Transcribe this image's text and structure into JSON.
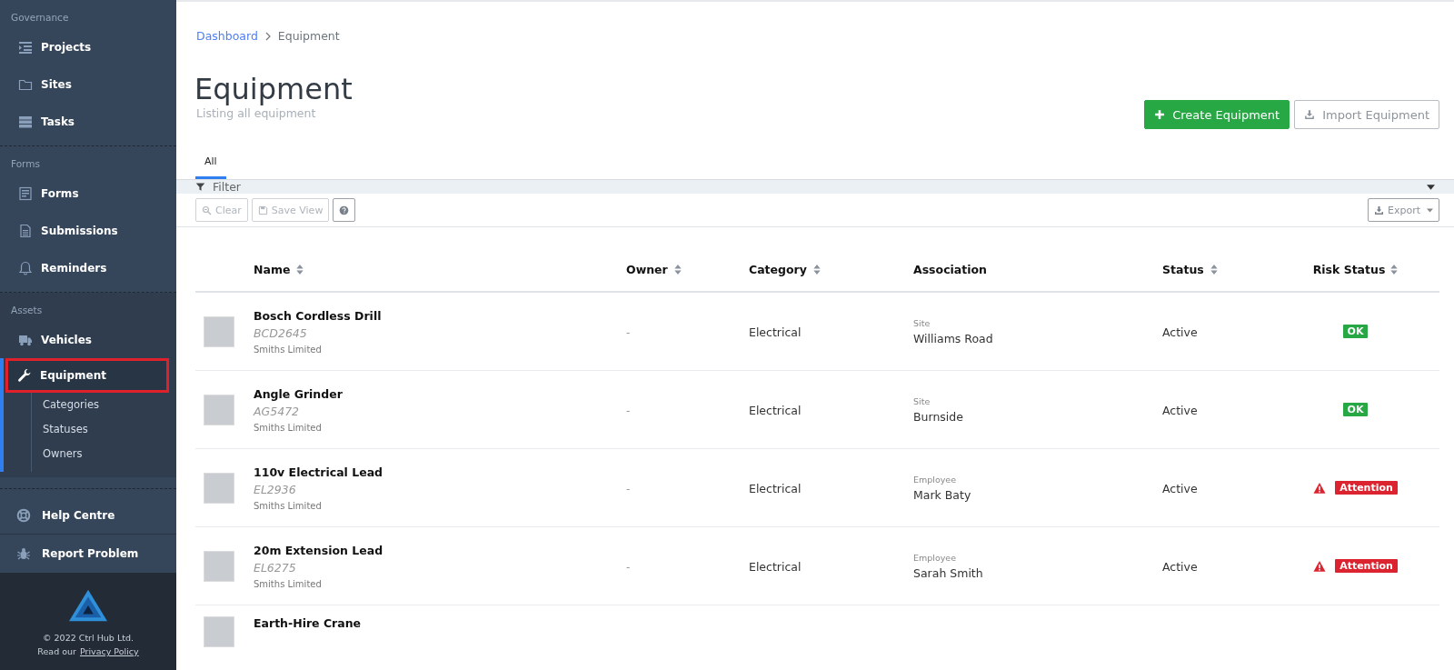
{
  "sidebar": {
    "sections": [
      {
        "label": "Governance",
        "items": [
          {
            "label": "Projects",
            "selected": false
          },
          {
            "label": "Sites",
            "selected": false
          },
          {
            "label": "Tasks",
            "selected": false
          }
        ]
      },
      {
        "label": "Forms",
        "items": [
          {
            "label": "Forms",
            "selected": false
          },
          {
            "label": "Submissions",
            "selected": false
          },
          {
            "label": "Reminders",
            "selected": false
          }
        ]
      },
      {
        "label": "Assets",
        "items": [
          {
            "label": "Vehicles",
            "selected": false
          },
          {
            "label": "Equipment",
            "selected": true,
            "children": [
              {
                "label": "Categories"
              },
              {
                "label": "Statuses"
              },
              {
                "label": "Owners"
              }
            ]
          }
        ]
      }
    ],
    "help": [
      {
        "label": "Help Centre"
      },
      {
        "label": "Report Problem"
      }
    ],
    "footer": {
      "copyright": "© 2022 Ctrl Hub Ltd.",
      "read": "Read our",
      "link": "Privacy Policy"
    }
  },
  "breadcrumb": [
    {
      "label": "Dashboard",
      "link": true
    },
    {
      "label": "Equipment",
      "link": false
    }
  ],
  "page": {
    "title": "Equipment",
    "subtitle": "Listing all equipment"
  },
  "actions": [
    {
      "label": "Create Equipment",
      "kind": "primary"
    },
    {
      "label": "Import Equipment",
      "kind": "secondary"
    }
  ],
  "tabs": [
    {
      "label": "All",
      "selected": true
    }
  ],
  "filter": {
    "label": "Filter",
    "expanded": false
  },
  "toolbar": [
    {
      "label": "Clear",
      "disabled": true
    },
    {
      "label": "Save View",
      "disabled": true
    },
    {
      "disabled": false
    }
  ],
  "export": {
    "label": "Export"
  },
  "table": {
    "columns": [
      {
        "label": "Name",
        "sortable": true
      },
      {
        "label": "Owner",
        "sortable": true
      },
      {
        "label": "Category",
        "sortable": true
      },
      {
        "label": "Association",
        "sortable": false
      },
      {
        "label": "Status",
        "sortable": true
      },
      {
        "label": "Risk Status",
        "sortable": true
      }
    ],
    "rows": [
      {
        "name": "Bosch Cordless Drill",
        "code": "BCD2645",
        "company": "Smiths Limited",
        "owner": "-",
        "category": "Electrical",
        "association_type": "Site",
        "association": "Williams Road",
        "status": "Active",
        "risk": {
          "kind": "ok",
          "label": "OK"
        }
      },
      {
        "name": "Angle Grinder",
        "code": "AG5472",
        "company": "Smiths Limited",
        "owner": "-",
        "category": "Electrical",
        "association_type": "Site",
        "association": "Burnside",
        "status": "Active",
        "risk": {
          "kind": "ok",
          "label": "OK"
        }
      },
      {
        "name": "110v Electrical Lead",
        "code": "EL2936",
        "company": "Smiths Limited",
        "owner": "-",
        "category": "Electrical",
        "association_type": "Employee",
        "association": "Mark Baty",
        "status": "Active",
        "risk": {
          "kind": "attention",
          "label": "Attention"
        }
      },
      {
        "name": "20m Extension Lead",
        "code": "EL6275",
        "company": "Smiths Limited",
        "owner": "-",
        "category": "Electrical",
        "association_type": "Employee",
        "association": "Sarah Smith",
        "status": "Active",
        "risk": {
          "kind": "attention",
          "label": "Attention"
        }
      },
      {
        "name": "Earth-Hire Crane"
      }
    ]
  }
}
